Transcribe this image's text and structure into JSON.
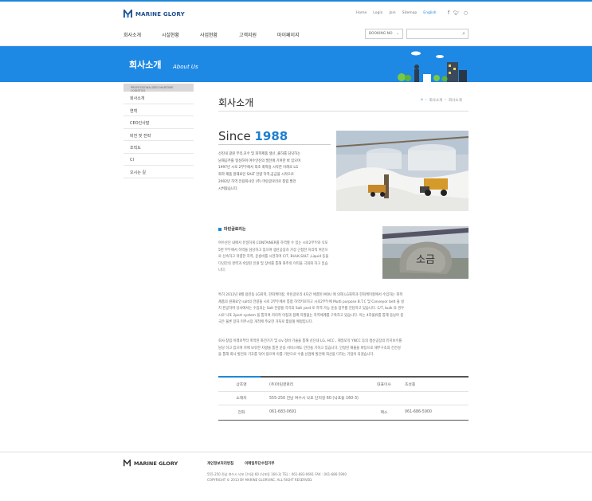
{
  "brand": {
    "name": "MARINE GLORY",
    "accent": "#1e88d9"
  },
  "util_links": [
    "Home",
    "Login",
    "Join",
    "Sitemap",
    "English"
  ],
  "sns_icons": [
    "facebook-icon",
    "twitter-icon",
    "blog-icon"
  ],
  "gnb": [
    "회사소개",
    "시설현황",
    "사업현황",
    "고객지원",
    "마이페이지"
  ],
  "booking": {
    "label": "BOOKING NO",
    "arrow": "⌄"
  },
  "hero": {
    "title": "회사소개",
    "subtitle": "About Us"
  },
  "lnb": {
    "header": "PROFESSIONALIZED MARITIME LOGISTICS",
    "items": [
      "회사소개",
      "연혁",
      "CEO인사말",
      "비전 및 전략",
      "조직도",
      "CI",
      "오시는 길"
    ]
  },
  "page_title": "회사소개",
  "breadcrumb": [
    "회사소개",
    "회사소개"
  ],
  "since": {
    "prefix": "Since",
    "year": "1988"
  },
  "intro_lines": [
    "선진내 광원 무리,포수 및 화학제품 생산 ,출하를 담당하는",
    "남해공주를 형성하여 여수안진의 발전에 기여한 바 있으며",
    "1997년 시로 2부두에서 최초 화학용 시작한 이래로 LG",
    "화학 제품 원재료인 SALT 전량 하역,공급을 시작으로",
    "2002년 하역 전용회사인 (주) 마린글로리로 창립 발전",
    "시켜왔습니다."
  ],
  "subsection_title": "마린글로리는",
  "para1_lines": [
    "여수산단 내에서 유일하게 CONTAINER를 하역할 수 있는 시로2부두와 낙포",
    "5번 부두에서 하역을 담당하고 있으며 생산공장과 가장 근접한 지리적 여건으",
    "로 신속하고 저렴한 하역, 운송비를 시현하며 C/T, BULK,SALT ,Liquid 등을",
    "다년간의 경력과 숙달된 인원 및 장비를 통해 화주의 이익을 극대화 하고 있습",
    "니다."
  ],
  "para2_lines": [
    "특히 2012년 8월 용만동 LG화학, 한화케미칼, 마린글로리 4자간 체결된 MOU 에 의해 LG화학과 한화케미칼에서 수입하는 화학",
    "제품의 원재료인 salt의 전량을 시로 2부두에서 통합 하역키로하고 시로2부두에 Multi purpose B.T.C 및 Conveyor belt 을 설",
    "치 완공하여 당사에서는 수입되는 Salt 전량을 각각의 Salt yard 로 하역 가능 운송 업무를 전담하고 있습니다. C/T, bulk 의 경우",
    "시로 낙포 2port system 을 통하여 저리적 이점과 함께 차질없는 하역체계를 구축하고 있습니다. 이는 4차물류를 통해 동남아 중",
    "국은 물론 장차 미주시장 개척에 주요한 거처로 활용될 예정입니다."
  ],
  "para3_lines": [
    "회사 창립 이래로부터 축적된 화전기기 및 s/v 정비 기술을 통해 산단내 LG, HCC , 제일모직 YNCC 등의 생산공장의 유지보수를",
    "담당 하고 있으며 지체 보유한 차량을 통한 운송 서비스에도 만전을 기하고 있습니다. 안정된 재물을 바탕으로 재무구조의 건전성",
    "을 통해 회사 발전의 기초를 닦아 왔으며 이를 기반으로 수출 산업에 발전에 최선을 다하는 기업이 되겠습니다."
  ],
  "info": {
    "rep_label": "상호명",
    "rep_value": "(주)마린글로리",
    "ceo_label": "대표이사",
    "ceo_value": "조성종",
    "addr_label": "소재지",
    "addr_value": "555-250 전남 여수시 낙포 단지길 60 (낙포동 160-3)",
    "tel_label": "전화",
    "tel_value": "061-683-0691",
    "fax_label": "팩스",
    "fax_value": "061-686-5900"
  },
  "footer": {
    "links": [
      "개인정보처리방침",
      "이메일무단수집거부"
    ],
    "address": "555-250 전남 여수시 낙포 단지길 60 (낙포동 160-3) TEL : 061-683-0691 FAX : 061-686-5900",
    "copyright": "COPYRIGHT © 2013 BY MARINE GLORY.INC. ALL RIGHT RESERVED."
  }
}
